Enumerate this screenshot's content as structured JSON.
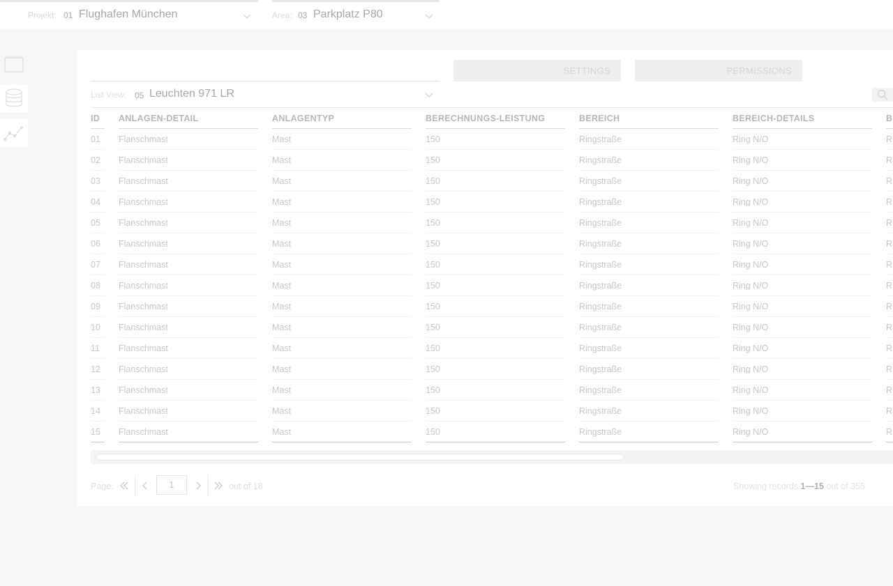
{
  "header": {
    "projekt": {
      "label": "Projekt:",
      "number": "01",
      "value": "Flughafen München"
    },
    "area": {
      "label": "Area:",
      "number": "03",
      "value": "Parkplatz P80"
    }
  },
  "sidebar": {
    "items": [
      {
        "icon": "window-icon"
      },
      {
        "icon": "database-icon"
      },
      {
        "icon": "line-chart-icon"
      }
    ]
  },
  "tabs": {
    "settings": "SETTINGS",
    "permissions": "PERMISSIONS"
  },
  "list_view": {
    "label": "List View:",
    "number": "05",
    "value": "Leuchten 971 LR"
  },
  "table": {
    "columns": [
      "ID",
      "ANLAGEN-DETAIL",
      "ANLAGENTYP",
      "BERECHNUNGS-LEISTUNG",
      "BEREICH",
      "BEREICH-DETAILS",
      "B"
    ],
    "rows": [
      [
        "01",
        "Flanschmast",
        "Mast",
        "150",
        "Ringstraße",
        "Ring N/O",
        "R"
      ],
      [
        "02",
        "Flanschmast",
        "Mast",
        "150",
        "Ringstraße",
        "Ring N/O",
        "R"
      ],
      [
        "03",
        "Flanschmast",
        "Mast",
        "150",
        "Ringstraße",
        "Ring N/O",
        "R"
      ],
      [
        "04",
        "Flanschmast",
        "Mast",
        "150",
        "Ringstraße",
        "Ring N/O",
        "R"
      ],
      [
        "05",
        "Flanschmast",
        "Mast",
        "150",
        "Ringstraße",
        "Ring N/O",
        "R"
      ],
      [
        "06",
        "Flanschmast",
        "Mast",
        "150",
        "Ringstraße",
        "Ring N/O",
        "R"
      ],
      [
        "07",
        "Flanschmast",
        "Mast",
        "150",
        "Ringstraße",
        "Ring N/O",
        "R"
      ],
      [
        "08",
        "Flanschmast",
        "Mast",
        "150",
        "Ringstraße",
        "Ring N/O",
        "R"
      ],
      [
        "09",
        "Flanschmast",
        "Mast",
        "150",
        "Ringstraße",
        "Ring N/O",
        "R"
      ],
      [
        "10",
        "Flanschmast",
        "Mast",
        "150",
        "Ringstraße",
        "Ring N/O",
        "R"
      ],
      [
        "11",
        "Flanschmast",
        "Mast",
        "150",
        "Ringstraße",
        "Ring N/O",
        "R"
      ],
      [
        "12",
        "Flanschmast",
        "Mast",
        "150",
        "Ringstraße",
        "Ring N/O",
        "R"
      ],
      [
        "13",
        "Flanschmast",
        "Mast",
        "150",
        "Ringstraße",
        "Ring N/O",
        "R"
      ],
      [
        "14",
        "Flanschmast",
        "Mast",
        "150",
        "Ringstraße",
        "Ring N/O",
        "R"
      ],
      [
        "15",
        "Flanschmast",
        "Mast",
        "150",
        "Ringstraße",
        "Ring N/O",
        "R"
      ]
    ]
  },
  "pagination": {
    "label": "Page:",
    "current": "1",
    "out_of": "out of 18"
  },
  "records": {
    "prefix": "Showing records",
    "range": "1—15",
    "suffix": "out of 355"
  },
  "colors": {
    "accent_text": "#a8a8a8",
    "muted_text": "#dadada",
    "panel_bg": "#ffffff",
    "page_bg": "#f7f7f7"
  }
}
